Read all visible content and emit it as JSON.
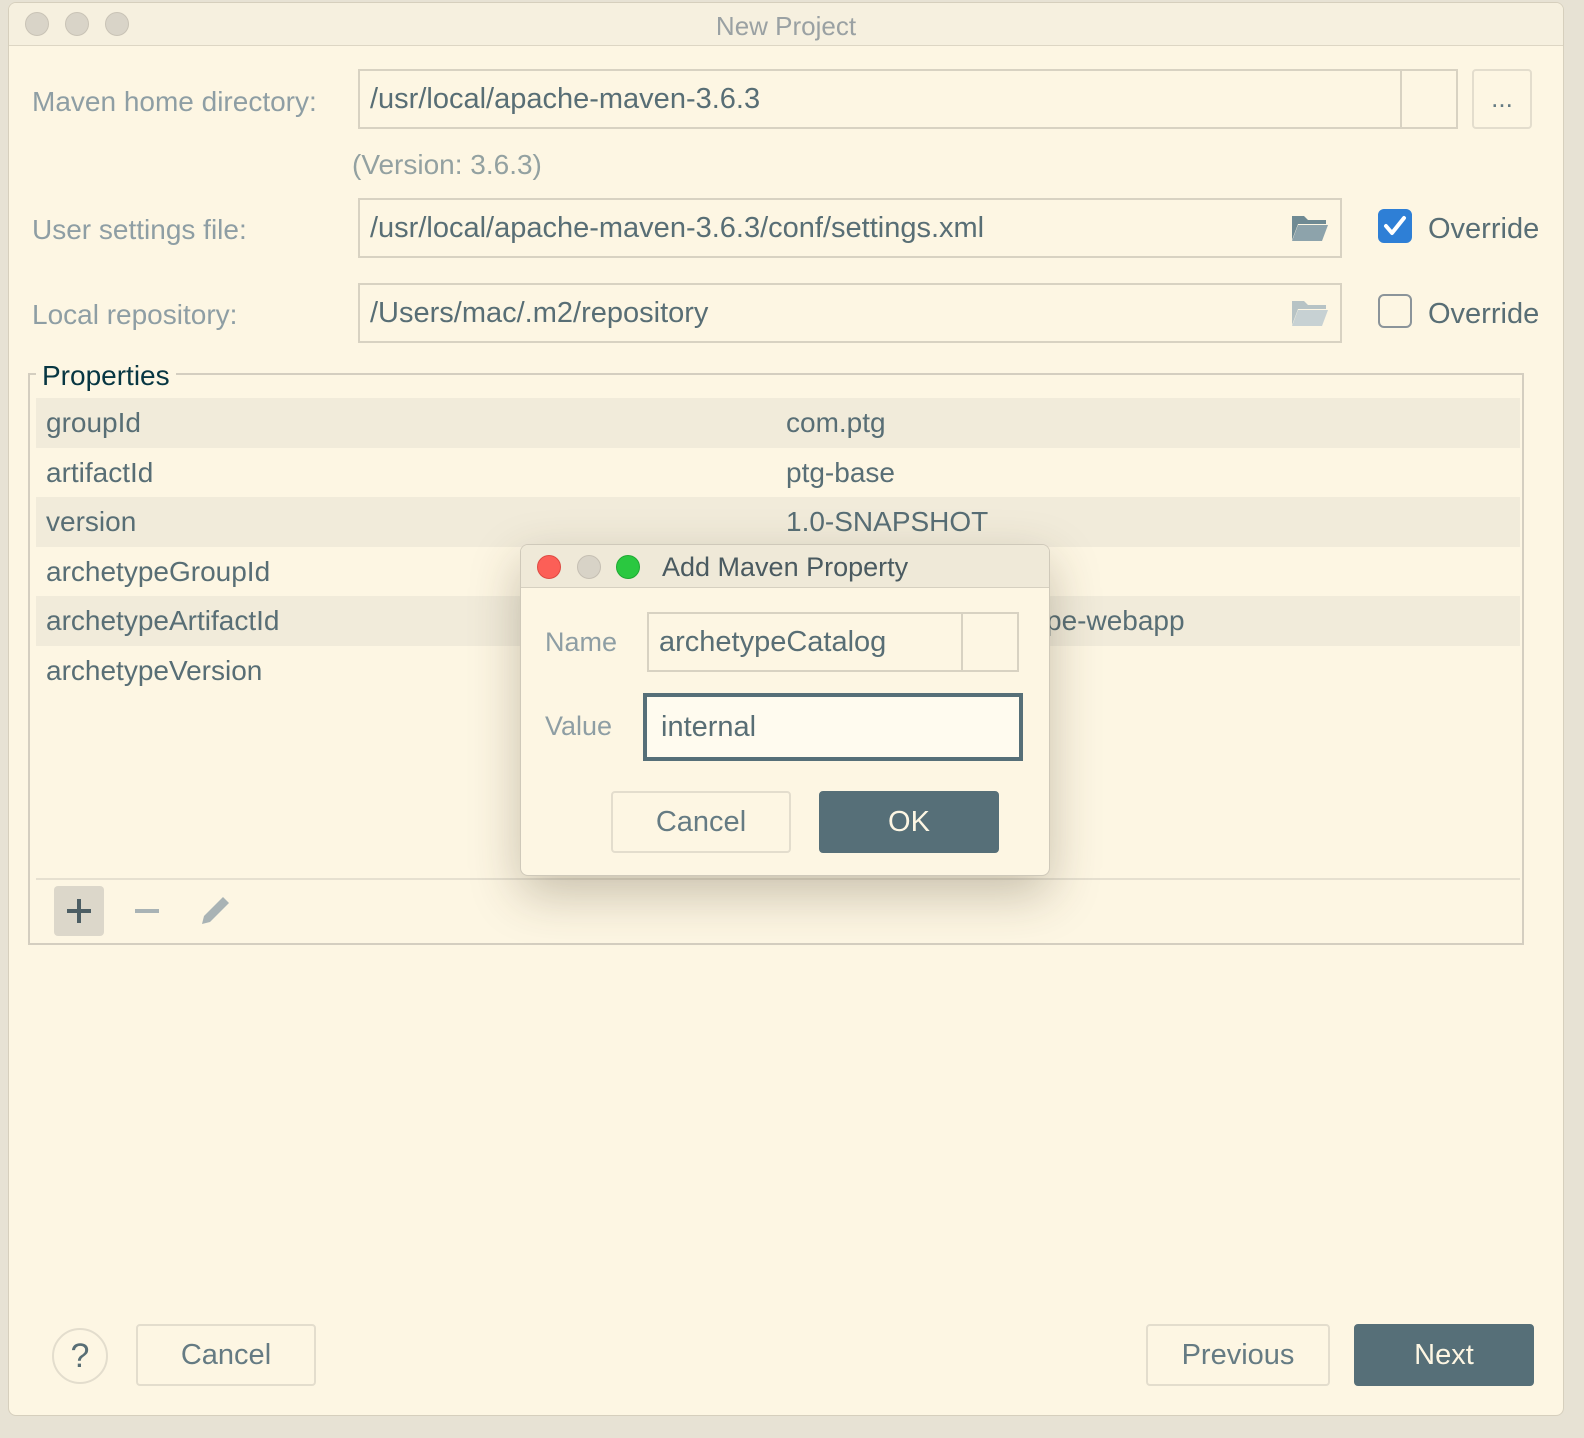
{
  "window": {
    "title": "New Project"
  },
  "maven_home": {
    "label": "Maven home directory:",
    "value": "/usr/local/apache-maven-3.6.3",
    "browse_label": "...",
    "version_note": "(Version: 3.6.3)"
  },
  "user_settings": {
    "label": "User settings file:",
    "value": "/usr/local/apache-maven-3.6.3/conf/settings.xml",
    "override_label": "Override",
    "override_checked": true
  },
  "local_repo": {
    "label": "Local repository:",
    "value": "/Users/mac/.m2/repository",
    "override_label": "Override",
    "override_checked": false
  },
  "properties": {
    "title": "Properties",
    "rows": [
      {
        "key": "groupId",
        "value": "com.ptg"
      },
      {
        "key": "artifactId",
        "value": "ptg-base"
      },
      {
        "key": "version",
        "value": "1.0-SNAPSHOT"
      },
      {
        "key": "archetypeGroupId",
        "value": ""
      },
      {
        "key": "archetypeArtifactId",
        "value": "pe-webapp"
      },
      {
        "key": "archetypeVersion",
        "value": ""
      }
    ],
    "toolbar": {
      "add_icon": "plus-icon",
      "remove_icon": "minus-icon",
      "edit_icon": "pencil-icon"
    }
  },
  "dialog": {
    "title": "Add Maven Property",
    "name_label": "Name",
    "name_value": "archetypeCatalog",
    "value_label": "Value",
    "value_value": "internal",
    "cancel_label": "Cancel",
    "ok_label": "OK"
  },
  "footer": {
    "help_label": "?",
    "cancel_label": "Cancel",
    "previous_label": "Previous",
    "next_label": "Next"
  },
  "colors": {
    "primary_button": "#566f78",
    "checkbox_checked": "#2e7fd6",
    "background": "#fdf6e3"
  }
}
